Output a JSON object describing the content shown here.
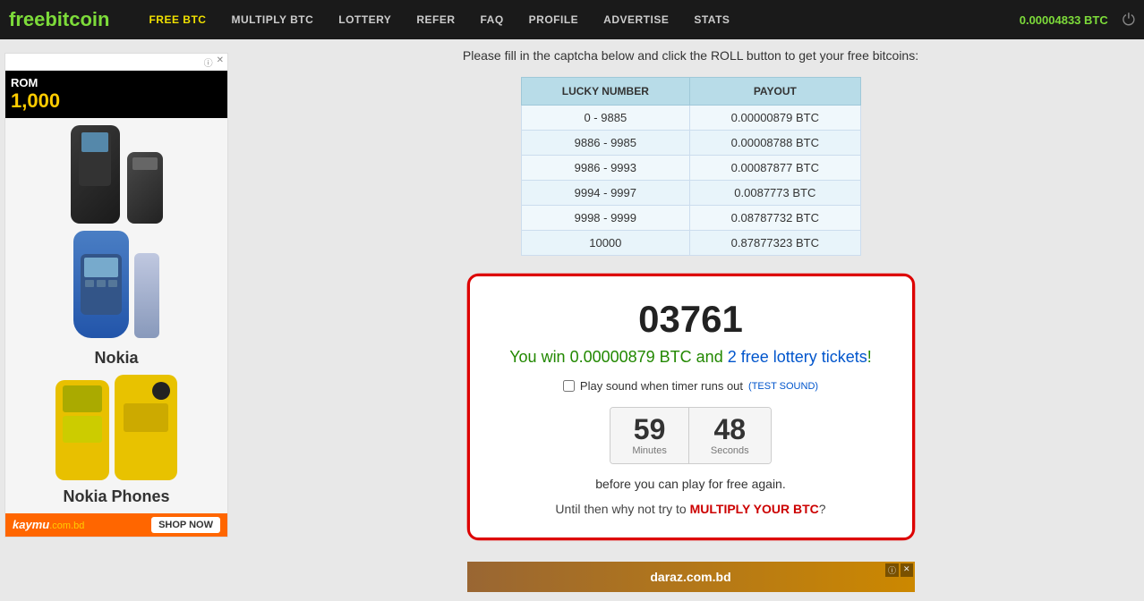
{
  "navbar": {
    "brand": "freebitcoin",
    "links": [
      {
        "label": "FREE BTC",
        "active": true
      },
      {
        "label": "MULTIPLY BTC",
        "active": false
      },
      {
        "label": "LOTTERY",
        "active": false
      },
      {
        "label": "REFER",
        "active": false
      },
      {
        "label": "FAQ",
        "active": false
      },
      {
        "label": "PROFILE",
        "active": false
      },
      {
        "label": "ADVERTISE",
        "active": false
      },
      {
        "label": "STATS",
        "active": false
      }
    ],
    "balance": "0.00004833 BTC"
  },
  "instruction": {
    "text": "Please fill in the captcha below and click the ROLL button to get your free bitcoins:"
  },
  "lucky_table": {
    "headers": [
      "LUCKY NUMBER",
      "PAYOUT"
    ],
    "rows": [
      {
        "range": "0 - 9885",
        "payout": "0.00000879 BTC"
      },
      {
        "range": "9886 - 9985",
        "payout": "0.00008788 BTC"
      },
      {
        "range": "9986 - 9993",
        "payout": "0.00087877 BTC"
      },
      {
        "range": "9994 - 9997",
        "payout": "0.0087773 BTC"
      },
      {
        "range": "9998 - 9999",
        "payout": "0.08787732 BTC"
      },
      {
        "range": "10000",
        "payout": "0.87877323 BTC"
      }
    ]
  },
  "result": {
    "lucky_number": "03761",
    "win_text_prefix": "You win 0.00000879 BTC and ",
    "win_text_link": "2 free lottery tickets",
    "win_text_suffix": "!",
    "sound_label": "Play sound when timer runs out",
    "test_sound_label": "(TEST SOUND)",
    "timer": {
      "minutes": "59",
      "minutes_label": "Minutes",
      "seconds": "48",
      "seconds_label": "Seconds"
    },
    "before_text": "before you can play for free again.",
    "until_text": "Until then why not try to ",
    "multiply_link": "MULTIPLY YOUR BTC",
    "until_suffix": "?"
  },
  "ad": {
    "top_bar_text": "i ×",
    "promo_rom": "ROM",
    "promo_price": "1,000",
    "brand_name": "kaymu",
    "brand_suffix": ".com.bd",
    "shop_btn": "SHOP NOW",
    "bottom_brand": "daraz.com.bd"
  }
}
